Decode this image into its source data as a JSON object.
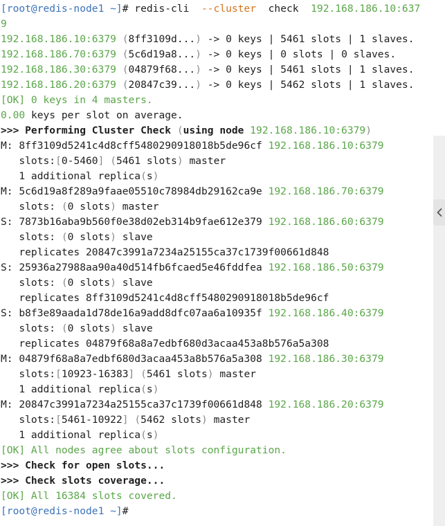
{
  "terminal": {
    "lines": [
      [
        [
          "c-blue",
          "[root@redis-node1 ~]"
        ],
        [
          "c-text",
          "# redis-cli  "
        ],
        [
          "c-orange",
          "--cluster"
        ],
        [
          "c-text",
          "  check  "
        ],
        [
          "c-green",
          "192.168.186.10:637"
        ]
      ],
      [
        [
          "c-green",
          "9"
        ]
      ],
      [
        [
          "c-green",
          "192.168.186.10:6379"
        ],
        [
          "c-text",
          " "
        ],
        [
          "c-gray",
          "("
        ],
        [
          "c-text",
          "8ff3109d..."
        ],
        [
          "c-gray",
          ")"
        ],
        [
          "c-text",
          " -> 0 keys | 5461 slots | 1 slaves."
        ]
      ],
      [
        [
          "c-green",
          "192.168.186.70:6379"
        ],
        [
          "c-text",
          " "
        ],
        [
          "c-gray",
          "("
        ],
        [
          "c-text",
          "5c6d19a8..."
        ],
        [
          "c-gray",
          ")"
        ],
        [
          "c-text",
          " -> 0 keys | 0 slots | 0 slaves."
        ]
      ],
      [
        [
          "c-green",
          "192.168.186.30:6379"
        ],
        [
          "c-text",
          " "
        ],
        [
          "c-gray",
          "("
        ],
        [
          "c-text",
          "04879f68..."
        ],
        [
          "c-gray",
          ")"
        ],
        [
          "c-text",
          " -> 0 keys | 5461 slots | 1 slaves."
        ]
      ],
      [
        [
          "c-green",
          "192.168.186.20:6379"
        ],
        [
          "c-text",
          " "
        ],
        [
          "c-gray",
          "("
        ],
        [
          "c-text",
          "20847c39..."
        ],
        [
          "c-gray",
          ")"
        ],
        [
          "c-text",
          " -> 0 keys | 5462 slots | 1 slaves."
        ]
      ],
      [
        [
          "c-green",
          "[OK] 0 keys in 4 masters."
        ]
      ],
      [
        [
          "c-green",
          "0.00"
        ],
        [
          "c-text",
          " keys per slot on average."
        ]
      ],
      [
        [
          "c-bold",
          ">>> Performing Cluster Check "
        ],
        [
          "c-gray",
          "("
        ],
        [
          "c-bold",
          "using node "
        ],
        [
          "c-green",
          "192.168.186.10:6379"
        ],
        [
          "c-gray",
          ")"
        ]
      ],
      [
        [
          "c-text",
          "M: 8ff3109d5241c4d8cff5480290918018b5de96cf "
        ],
        [
          "c-green",
          "192.168.186.10:6379"
        ]
      ],
      [
        [
          "c-text",
          "   slots:"
        ],
        [
          "c-gray",
          "["
        ],
        [
          "c-text",
          "0-5460"
        ],
        [
          "c-gray",
          "]"
        ],
        [
          "c-text",
          " "
        ],
        [
          "c-gray",
          "("
        ],
        [
          "c-text",
          "5461 slots"
        ],
        [
          "c-gray",
          ")"
        ],
        [
          "c-text",
          " master"
        ]
      ],
      [
        [
          "c-text",
          "   1 additional replica"
        ],
        [
          "c-gray",
          "("
        ],
        [
          "c-text",
          "s"
        ],
        [
          "c-gray",
          ")"
        ]
      ],
      [
        [
          "c-text",
          "M: 5c6d19a8f289a9faae05510c78984db29162ca9e "
        ],
        [
          "c-green",
          "192.168.186.70:6379"
        ]
      ],
      [
        [
          "c-text",
          "   slots: "
        ],
        [
          "c-gray",
          "("
        ],
        [
          "c-text",
          "0 slots"
        ],
        [
          "c-gray",
          ")"
        ],
        [
          "c-text",
          " master"
        ]
      ],
      [
        [
          "c-text",
          "S: 7873b16aba9b560f0e38d02eb314b9fae612e379 "
        ],
        [
          "c-green",
          "192.168.186.60:6379"
        ]
      ],
      [
        [
          "c-text",
          "   slots: "
        ],
        [
          "c-gray",
          "("
        ],
        [
          "c-text",
          "0 slots"
        ],
        [
          "c-gray",
          ")"
        ],
        [
          "c-text",
          " slave"
        ]
      ],
      [
        [
          "c-text",
          "   replicates 20847c3991a7234a25155ca37c1739f00661d848"
        ]
      ],
      [
        [
          "c-text",
          "S: 25936a27988aa90a40d514fb6fcaed5e46fddfea "
        ],
        [
          "c-green",
          "192.168.186.50:6379"
        ]
      ],
      [
        [
          "c-text",
          "   slots: "
        ],
        [
          "c-gray",
          "("
        ],
        [
          "c-text",
          "0 slots"
        ],
        [
          "c-gray",
          ")"
        ],
        [
          "c-text",
          " slave"
        ]
      ],
      [
        [
          "c-text",
          "   replicates 8ff3109d5241c4d8cff5480290918018b5de96cf"
        ]
      ],
      [
        [
          "c-text",
          "S: b8f3e89aada1d78de16a9add8dfc07aa6a10935f "
        ],
        [
          "c-green",
          "192.168.186.40:6379"
        ]
      ],
      [
        [
          "c-text",
          "   slots: "
        ],
        [
          "c-gray",
          "("
        ],
        [
          "c-text",
          "0 slots"
        ],
        [
          "c-gray",
          ")"
        ],
        [
          "c-text",
          " slave"
        ]
      ],
      [
        [
          "c-text",
          "   replicates 04879f68a8a7edbf680d3acaa453a8b576a5a308"
        ]
      ],
      [
        [
          "c-text",
          "M: 04879f68a8a7edbf680d3acaa453a8b576a5a308 "
        ],
        [
          "c-green",
          "192.168.186.30:6379"
        ]
      ],
      [
        [
          "c-text",
          "   slots:"
        ],
        [
          "c-gray",
          "["
        ],
        [
          "c-text",
          "10923-16383"
        ],
        [
          "c-gray",
          "]"
        ],
        [
          "c-text",
          " "
        ],
        [
          "c-gray",
          "("
        ],
        [
          "c-text",
          "5461 slots"
        ],
        [
          "c-gray",
          ")"
        ],
        [
          "c-text",
          " master"
        ]
      ],
      [
        [
          "c-text",
          "   1 additional replica"
        ],
        [
          "c-gray",
          "("
        ],
        [
          "c-text",
          "s"
        ],
        [
          "c-gray",
          ")"
        ]
      ],
      [
        [
          "c-text",
          "M: 20847c3991a7234a25155ca37c1739f00661d848 "
        ],
        [
          "c-green",
          "192.168.186.20:6379"
        ]
      ],
      [
        [
          "c-text",
          "   slots:"
        ],
        [
          "c-gray",
          "["
        ],
        [
          "c-text",
          "5461-10922"
        ],
        [
          "c-gray",
          "]"
        ],
        [
          "c-text",
          " "
        ],
        [
          "c-gray",
          "("
        ],
        [
          "c-text",
          "5462 slots"
        ],
        [
          "c-gray",
          ")"
        ],
        [
          "c-text",
          " master"
        ]
      ],
      [
        [
          "c-text",
          "   1 additional replica"
        ],
        [
          "c-gray",
          "("
        ],
        [
          "c-text",
          "s"
        ],
        [
          "c-gray",
          ")"
        ]
      ],
      [
        [
          "c-green",
          "[OK] All nodes agree about slots configuration."
        ]
      ],
      [
        [
          "c-bold",
          ">>> Check for open slots..."
        ]
      ],
      [
        [
          "c-bold",
          ">>> Check slots coverage..."
        ]
      ],
      [
        [
          "c-green",
          "[OK] All 16384 slots covered."
        ]
      ],
      [
        [
          "c-blue",
          "[root@redis-node1 ~]"
        ],
        [
          "c-text",
          "#"
        ]
      ]
    ]
  },
  "ui": {
    "collapse_icon": "chevron-left-icon"
  }
}
